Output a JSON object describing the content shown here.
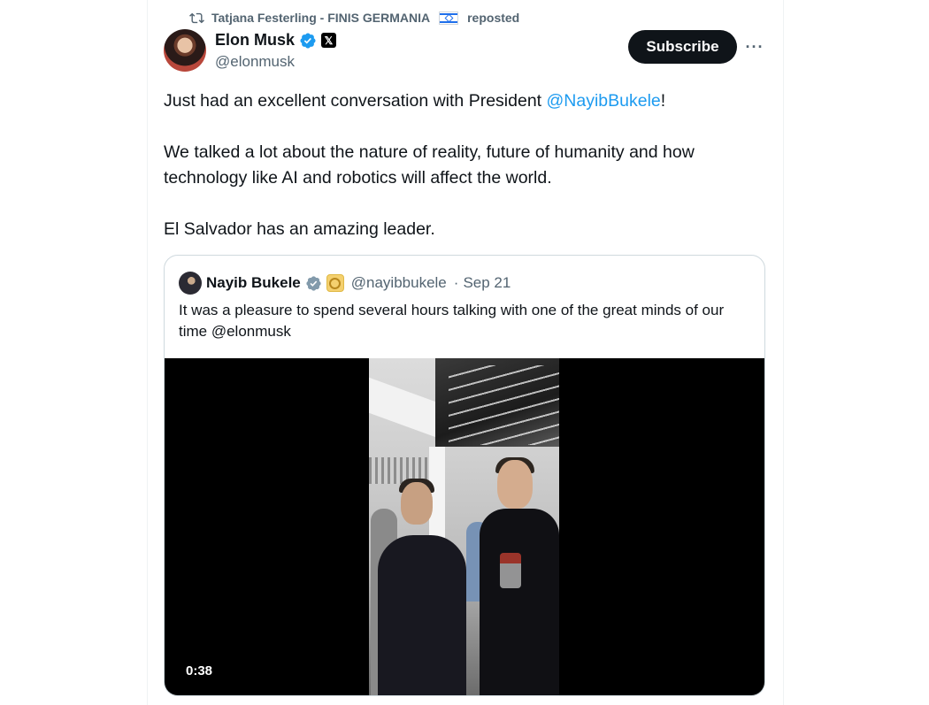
{
  "repost": {
    "reposter": "Tatjana Festerling - FINIS GERMANIA",
    "suffix": "reposted"
  },
  "tweet": {
    "author_name": "Elon Musk",
    "author_handle": "@elonmusk",
    "subscribe_label": "Subscribe",
    "more_label": "···",
    "text_line1_before": "Just had an excellent conversation with President ",
    "text_line1_mention": "@NayibBukele",
    "text_line1_after": "!",
    "text_para2": "We talked a lot about the nature of reality, future of humanity and how technology like AI and robotics will affect the world.",
    "text_para3": "El Salvador has an amazing leader."
  },
  "quote": {
    "author_name": "Nayib Bukele",
    "author_handle": "@nayibbukele",
    "separator": "·",
    "date": "Sep 21",
    "text": "It was a pleasure to spend several hours talking with one of the great minds of our time @elonmusk",
    "video_duration": "0:38"
  },
  "colors": {
    "accent": "#1d9bf0",
    "text": "#0f1419",
    "muted": "#536471",
    "button_bg": "#0f1419"
  },
  "icons": [
    "repost-icon",
    "israel-flag-icon",
    "verified-icon",
    "x-affiliate-icon",
    "more-icon",
    "gold-affiliate-icon"
  ]
}
